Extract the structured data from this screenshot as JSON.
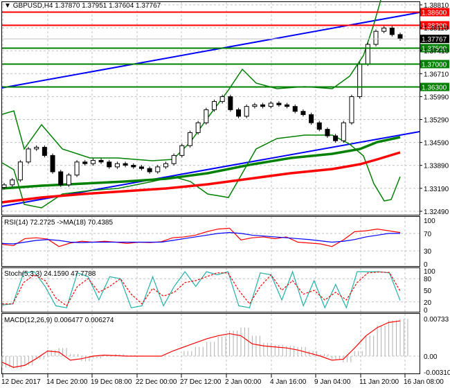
{
  "header": {
    "symbol": "GBPUSD,H4",
    "ohlc": "1.37870 1.37951 1.37604 1.37767"
  },
  "price_axis": [
    "1.38810",
    "1.38110",
    "1.37410",
    "1.36710",
    "1.35990",
    "1.35290",
    "1.34590",
    "1.33890",
    "1.33190",
    "1.32490"
  ],
  "levels": [
    {
      "label": "1.38600",
      "price": 1.386,
      "color": "#ff0000"
    },
    {
      "label": "1.38200",
      "price": 1.382,
      "color": "#ff0000"
    },
    {
      "label": "1.37500",
      "price": 1.375,
      "color": "#008000"
    },
    {
      "label": "1.37000",
      "price": 1.37,
      "color": "#008000"
    },
    {
      "label": "1.36300",
      "price": 1.363,
      "color": "#008000"
    }
  ],
  "current_price": {
    "label": "1.37767",
    "price": 1.37767
  },
  "rsi": {
    "title": "RSI(14) 72.2725  ->MA(18) 70.4385",
    "axis": [
      "100",
      "70",
      "30",
      "0"
    ]
  },
  "stoch": {
    "title": "Stoch(5,3,3) 24.1590 47.7788",
    "axis": [
      "100",
      "80",
      "50",
      "20",
      "0"
    ]
  },
  "macd": {
    "title": "MACD(12,26,9) 0.006477 0.006274",
    "axis": [
      "0.00733",
      "0.00",
      "-0.003105"
    ]
  },
  "time_axis": [
    "12 Dec 2017",
    "14 Dec 20:00",
    "19 Dec 08:00",
    "22 Dec 00:00",
    "27 Dec 12:00",
    "2 Jan 00:00",
    "4 Jan 16:00",
    "9 Jan 04:00",
    "11 Jan 20:00",
    "16 Jan 08:00"
  ],
  "chart_data": {
    "type": "candlestick",
    "title": "GBPUSD,H4",
    "ylim": [
      1.3249,
      1.3881
    ],
    "closes": [
      1.333,
      1.3345,
      1.34,
      1.344,
      1.3445,
      1.342,
      1.337,
      1.333,
      1.336,
      1.34,
      1.3395,
      1.3405,
      1.34,
      1.3385,
      1.3395,
      1.339,
      1.3385,
      1.338,
      1.337,
      1.3385,
      1.3395,
      1.342,
      1.345,
      1.349,
      1.352,
      1.356,
      1.3585,
      1.36,
      1.356,
      1.354,
      1.357,
      1.3575,
      1.357,
      1.358,
      1.3575,
      1.357,
      1.3555,
      1.3545,
      1.352,
      1.35,
      1.348,
      1.3465,
      1.352,
      1.36,
      1.37,
      1.376,
      1.38,
      1.381,
      1.379,
      1.3777
    ],
    "rsi": [
      45,
      42,
      58,
      60,
      57,
      40,
      48,
      52,
      50,
      52,
      50,
      47,
      50,
      49,
      51,
      60,
      62,
      66,
      74,
      80,
      82,
      55,
      60,
      62,
      58,
      62,
      50,
      48,
      46,
      40,
      55,
      74,
      76,
      80,
      76,
      72
    ],
    "rsi_ma": [
      47,
      46,
      50,
      54,
      56,
      54,
      50,
      49,
      50,
      50,
      50,
      50,
      50,
      50,
      50,
      54,
      58,
      62,
      66,
      70,
      72,
      70,
      66,
      64,
      62,
      60,
      58,
      56,
      53,
      50,
      52,
      56,
      62,
      66,
      70,
      70
    ],
    "stoch_main": [
      12,
      15,
      95,
      98,
      60,
      10,
      5,
      95,
      85,
      25,
      85,
      80,
      5,
      10,
      85,
      10,
      60,
      98,
      60,
      98,
      90,
      98,
      10,
      5,
      95,
      90,
      25,
      98,
      10,
      75,
      5,
      65,
      5,
      98,
      98,
      98,
      95,
      24
    ],
    "stoch_signal": [
      15,
      15,
      70,
      90,
      75,
      30,
      10,
      60,
      80,
      45,
      60,
      80,
      40,
      15,
      55,
      35,
      45,
      70,
      75,
      85,
      95,
      95,
      50,
      15,
      60,
      90,
      50,
      75,
      40,
      50,
      25,
      45,
      25,
      70,
      95,
      97,
      96,
      48
    ],
    "macd_hist": [
      -0.0022,
      -0.0024,
      -0.0018,
      -0.0006,
      0.0012,
      0.0016,
      0.0004,
      -0.001,
      -0.0004,
      0.0002,
      0.0004,
      0.0002,
      0.0001,
      0.0,
      0.0,
      0.0,
      0.001,
      0.0018,
      0.0028,
      0.0038,
      0.005,
      0.0056,
      0.004,
      0.0026,
      0.0022,
      0.002,
      0.0018,
      0.001,
      0.0004,
      -0.0006,
      -0.0012,
      0.001,
      0.004,
      0.006,
      0.007,
      0.0073
    ],
    "macd_signal": [
      -0.0012,
      -0.0022,
      -0.0018,
      -0.0005,
      0.001,
      0.0008,
      -0.0008,
      -0.0005,
      0.0,
      0.0002,
      0.0001,
      0.0,
      0.0,
      0.0,
      0.0,
      0.001,
      0.0018,
      0.0026,
      0.0034,
      0.004,
      0.0044,
      0.004,
      0.0024,
      0.002,
      0.0018,
      0.0016,
      0.0012,
      0.0006,
      0.0,
      -0.0008,
      -0.0006,
      0.0016,
      0.004,
      0.0056,
      0.0066,
      0.0069
    ]
  }
}
